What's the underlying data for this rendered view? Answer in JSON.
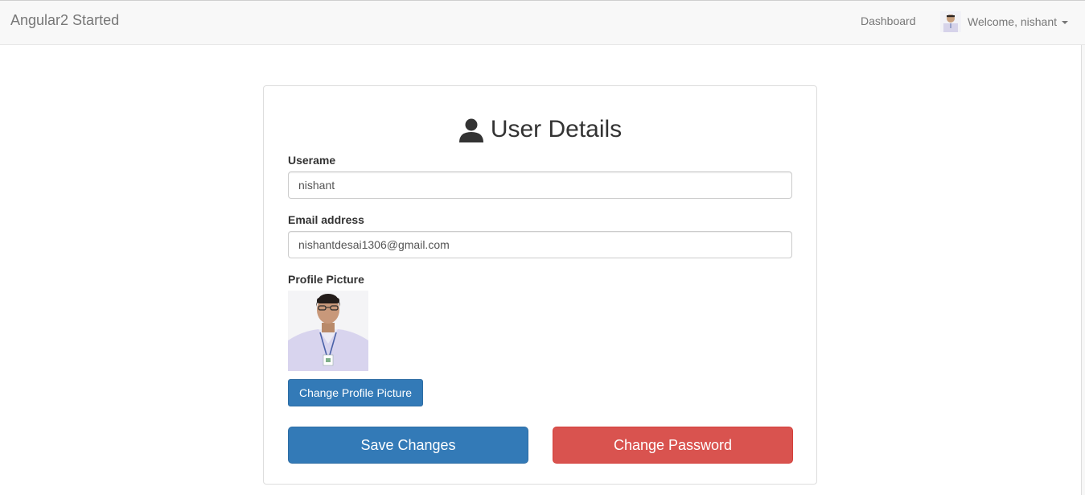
{
  "navbar": {
    "brand": "Angular2 Started",
    "dashboard_link": "Dashboard",
    "welcome_text": "Welcome, nishant"
  },
  "form": {
    "title": "User Details",
    "username": {
      "label": "Userame",
      "value": "nishant"
    },
    "email": {
      "label": "Email address",
      "value": "nishantdesai1306@gmail.com"
    },
    "profile_picture": {
      "label": "Profile Picture"
    },
    "change_picture_button": "Change Profile Picture",
    "save_button": "Save Changes",
    "change_password_button": "Change Password"
  },
  "colors": {
    "primary": "#337ab7",
    "danger": "#d9534f",
    "navbar_bg": "#f8f8f8"
  },
  "icons": [
    "user-avatar-icon",
    "caret-down-icon",
    "user-icon"
  ]
}
